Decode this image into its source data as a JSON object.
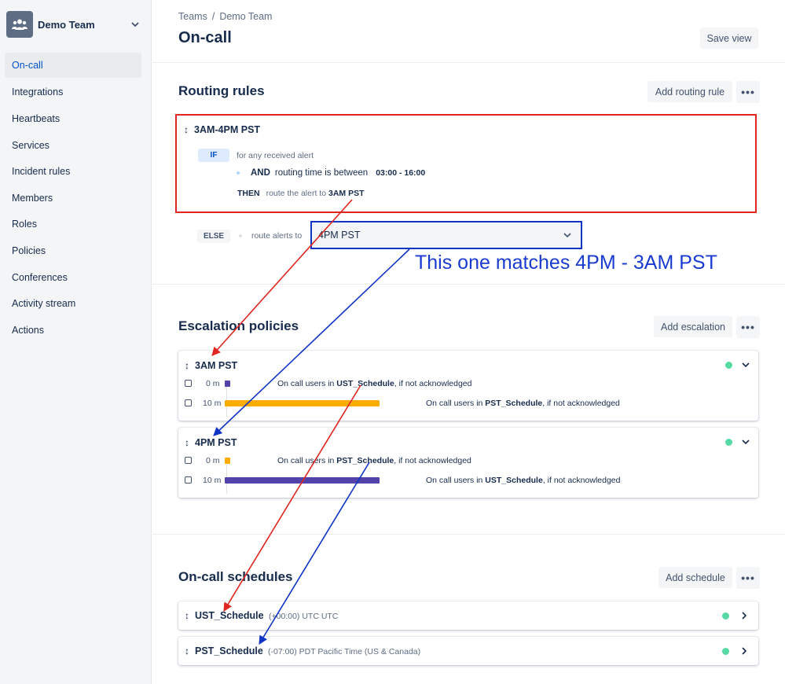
{
  "sidebar": {
    "team_name": "Demo Team",
    "items": [
      {
        "label": "On-call",
        "active": true
      },
      {
        "label": "Integrations"
      },
      {
        "label": "Heartbeats"
      },
      {
        "label": "Services"
      },
      {
        "label": "Incident rules"
      },
      {
        "label": "Members"
      },
      {
        "label": "Roles"
      },
      {
        "label": "Policies"
      },
      {
        "label": "Conferences"
      },
      {
        "label": "Activity stream"
      },
      {
        "label": "Actions"
      }
    ]
  },
  "header": {
    "breadcrumb": [
      "Teams",
      "Demo Team"
    ],
    "breadcrumb_sep": "/",
    "title": "On-call",
    "save_view": "Save view"
  },
  "routing": {
    "title": "Routing rules",
    "add_button": "Add routing rule",
    "rule": {
      "name": "3AM-4PM PST",
      "if_label": "IF",
      "if_text": "for any received alert",
      "and_label": "AND",
      "and_text": "routing time is between",
      "time_range": "03:00 - 16:00",
      "then_label": "THEN",
      "then_text": "route the alert to",
      "then_target": "3AM PST"
    },
    "else": {
      "label": "ELSE",
      "text": "route alerts to",
      "selected": "4PM PST"
    }
  },
  "annotation": {
    "text": "This one matches 4PM - 3AM PST",
    "red_color": "#e0261f",
    "blue_color": "#1034c6"
  },
  "escalation": {
    "title": "Escalation policies",
    "add_button": "Add escalation",
    "policies": [
      {
        "name": "3AM PST",
        "steps": [
          {
            "time": "0 m",
            "prefix": "On call users in",
            "schedule": "UST_Schedule",
            "suffix": ", if not acknowledged",
            "color": "#5243aa"
          },
          {
            "time": "10 m",
            "prefix": "On call users in",
            "schedule": "PST_Schedule",
            "suffix": ", if not acknowledged",
            "color": "#ffab00"
          }
        ]
      },
      {
        "name": "4PM PST",
        "steps": [
          {
            "time": "0 m",
            "prefix": "On call users in",
            "schedule": "PST_Schedule",
            "suffix": ", if not acknowledged",
            "color": "#ffab00"
          },
          {
            "time": "10 m",
            "prefix": "On call users in",
            "schedule": "UST_Schedule",
            "suffix": ", if not acknowledged",
            "color": "#5243aa"
          }
        ]
      }
    ]
  },
  "schedules": {
    "title": "On-call schedules",
    "add_button": "Add schedule",
    "items": [
      {
        "name": "UST_Schedule",
        "tz": "(+00:00) UTC UTC"
      },
      {
        "name": "PST_Schedule",
        "tz": "(-07:00) PDT Pacific Time (US & Canada)"
      }
    ]
  },
  "icons": {
    "more": "•••",
    "sort": "↕"
  }
}
